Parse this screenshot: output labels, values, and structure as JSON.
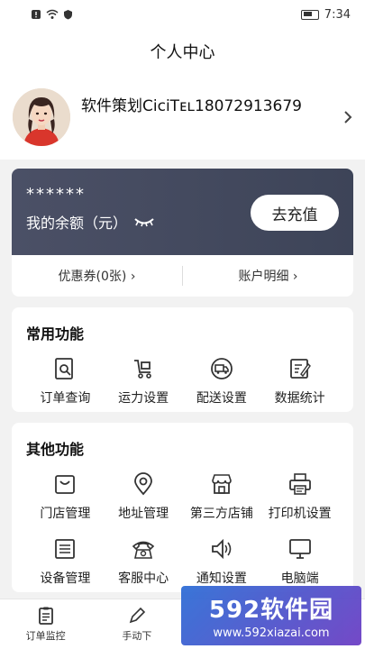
{
  "status_bar": {
    "time": "7:34"
  },
  "header": {
    "title": "个人中心"
  },
  "profile": {
    "name": "软件策划CiciTᴇʟ18072913679"
  },
  "balance": {
    "amount": "******",
    "label": "我的余额（元）",
    "recharge_label": "去充值",
    "coupons_label": "优惠券(0张)",
    "account_detail_label": "账户明细"
  },
  "common_functions": {
    "title": "常用功能",
    "items": [
      {
        "label": "订单查询",
        "icon": "order-search-icon"
      },
      {
        "label": "运力设置",
        "icon": "cart-icon"
      },
      {
        "label": "配送设置",
        "icon": "truck-icon"
      },
      {
        "label": "数据统计",
        "icon": "edit-doc-icon"
      }
    ]
  },
  "other_functions": {
    "title": "其他功能",
    "items": [
      {
        "label": "门店管理",
        "icon": "store-bag-icon"
      },
      {
        "label": "地址管理",
        "icon": "location-icon"
      },
      {
        "label": "第三方店铺",
        "icon": "shop-icon"
      },
      {
        "label": "打印机设置",
        "icon": "printer-icon"
      },
      {
        "label": "设备管理",
        "icon": "device-list-icon"
      },
      {
        "label": "客服中心",
        "icon": "phone-icon"
      },
      {
        "label": "通知设置",
        "icon": "speaker-icon"
      },
      {
        "label": "电脑端",
        "icon": "monitor-icon"
      }
    ]
  },
  "tabbar": {
    "tabs": [
      {
        "label": "订单监控",
        "icon": "clipboard-icon"
      },
      {
        "label": "手动下",
        "icon": "pen-icon"
      }
    ]
  },
  "watermark": {
    "main": "592软件园",
    "sub": "www.592xiazai.com"
  }
}
